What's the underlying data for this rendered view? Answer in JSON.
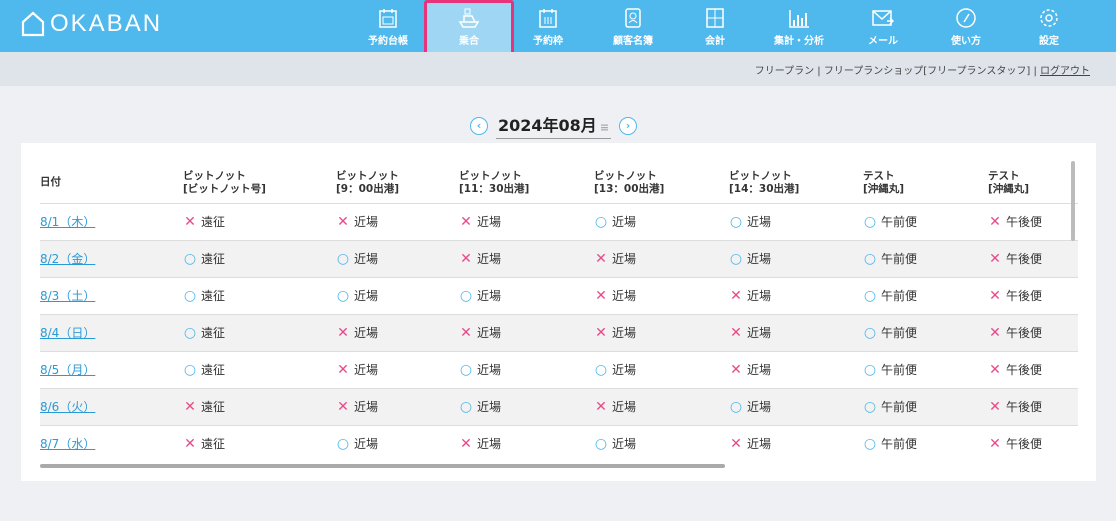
{
  "app": {
    "logo": "OKABAN"
  },
  "nav": [
    {
      "label": "予約台帳",
      "icon": "calendar-icon"
    },
    {
      "label": "乗合",
      "icon": "boat-icon",
      "active": true
    },
    {
      "label": "予約枠",
      "icon": "calendar-frame-icon"
    },
    {
      "label": "顧客名簿",
      "icon": "address-book-icon"
    },
    {
      "label": "会計",
      "icon": "calculator-icon"
    },
    {
      "label": "集計・分析",
      "icon": "bar-chart-icon"
    },
    {
      "label": "メール",
      "icon": "mail-icon"
    },
    {
      "label": "使い方",
      "icon": "compass-icon"
    },
    {
      "label": "設定",
      "icon": "gear-icon"
    }
  ],
  "account": {
    "plan": "フリープラン",
    "shop": "フリープランショップ[フリープランスタッフ]",
    "logout": "ログアウト"
  },
  "month": {
    "label": "2024年08月",
    "prev": "‹",
    "next": "›",
    "menu": "≡"
  },
  "table": {
    "headers": [
      [
        "日付",
        ""
      ],
      [
        "ビットノット",
        "[ビットノット号]"
      ],
      [
        "ビットノット",
        "[9：00出港]"
      ],
      [
        "ビットノット",
        "[11：30出港]"
      ],
      [
        "ビットノット",
        "[13：00出港]"
      ],
      [
        "ビットノット",
        "[14：30出港]"
      ],
      [
        "テスト",
        "[沖縄丸]"
      ],
      [
        "テスト",
        "[沖縄丸]"
      ]
    ],
    "labels": [
      "遠征",
      "近場",
      "近場",
      "近場",
      "近場",
      "午前便",
      "午後便"
    ],
    "symbols": {
      "x": "✕",
      "o": "○"
    },
    "rows": [
      {
        "date": "8/1（木）",
        "status": [
          "x",
          "x",
          "x",
          "o",
          "o",
          "o",
          "x"
        ]
      },
      {
        "date": "8/2（金）",
        "status": [
          "o",
          "o",
          "x",
          "x",
          "o",
          "o",
          "x"
        ]
      },
      {
        "date": "8/3（土）",
        "status": [
          "o",
          "o",
          "o",
          "x",
          "x",
          "o",
          "x"
        ]
      },
      {
        "date": "8/4（日）",
        "status": [
          "o",
          "x",
          "x",
          "x",
          "x",
          "o",
          "x"
        ]
      },
      {
        "date": "8/5（月）",
        "status": [
          "o",
          "x",
          "o",
          "o",
          "x",
          "o",
          "x"
        ]
      },
      {
        "date": "8/6（火）",
        "status": [
          "x",
          "x",
          "o",
          "x",
          "o",
          "o",
          "x"
        ]
      },
      {
        "date": "8/7（水）",
        "status": [
          "x",
          "o",
          "x",
          "o",
          "x",
          "o",
          "x"
        ]
      }
    ]
  },
  "colors": {
    "header": "#4fb8ec",
    "active_border": "#e8327a",
    "x": "#e84a8a",
    "o": "#4fb8ec",
    "link": "#2a9ad6"
  }
}
